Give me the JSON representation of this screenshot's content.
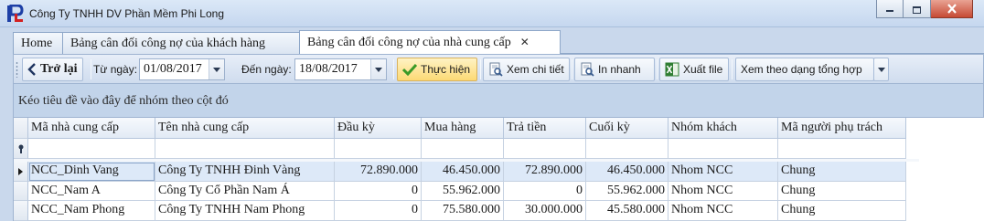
{
  "window": {
    "title": "Công Ty TNHH DV Phần Mềm Phi Long",
    "logo_icon": "phi-long-logo"
  },
  "tabs": [
    {
      "label": "Home",
      "active": false
    },
    {
      "label": "Bảng cân đối công nợ của khách hàng",
      "active": false
    },
    {
      "label": "Bảng cân đối công nợ của nhà cung cấp",
      "active": true,
      "close": "✕"
    }
  ],
  "toolbar": {
    "back_label": "Trở lại",
    "from_label": "Từ ngày:",
    "from_value": "01/08/2017",
    "to_label": "Đến ngày:",
    "to_value": "18/08/2017",
    "execute_label": "Thực hiện",
    "view_detail_label": "Xem chi tiết",
    "quick_print_label": "In nhanh",
    "export_label": "Xuất file",
    "summary_view_label": "Xem theo dạng tổng hợp"
  },
  "group_panel": {
    "text": "Kéo tiêu đề vào đây để nhóm theo cột đó"
  },
  "grid": {
    "columns": [
      "Mã nhà cung cấp",
      "Tên nhà cung cấp",
      "Đầu kỳ",
      "Mua hàng",
      "Trả tiền",
      "Cuối kỳ",
      "Nhóm khách",
      "Mã người phụ trách"
    ],
    "rows": [
      [
        "NCC_Dinh Vang",
        "Công Ty TNHH Đinh Vàng",
        "72.890.000",
        "46.450.000",
        "72.890.000",
        "46.450.000",
        "Nhom NCC",
        "Chung"
      ],
      [
        "NCC_Nam A",
        "Công Ty Cổ Phần Nam Á",
        "0",
        "55.962.000",
        "0",
        "55.962.000",
        "Nhom NCC",
        "Chung"
      ],
      [
        "NCC_Nam Phong",
        "Công Ty TNHH Nam Phong",
        "0",
        "75.580.000",
        "30.000.000",
        "45.580.000",
        "Nhom NCC",
        "Chung"
      ]
    ]
  },
  "colors": {
    "accent": "#fcd975",
    "selected_row": "#dde9f8",
    "close_button": "#c64a34"
  }
}
